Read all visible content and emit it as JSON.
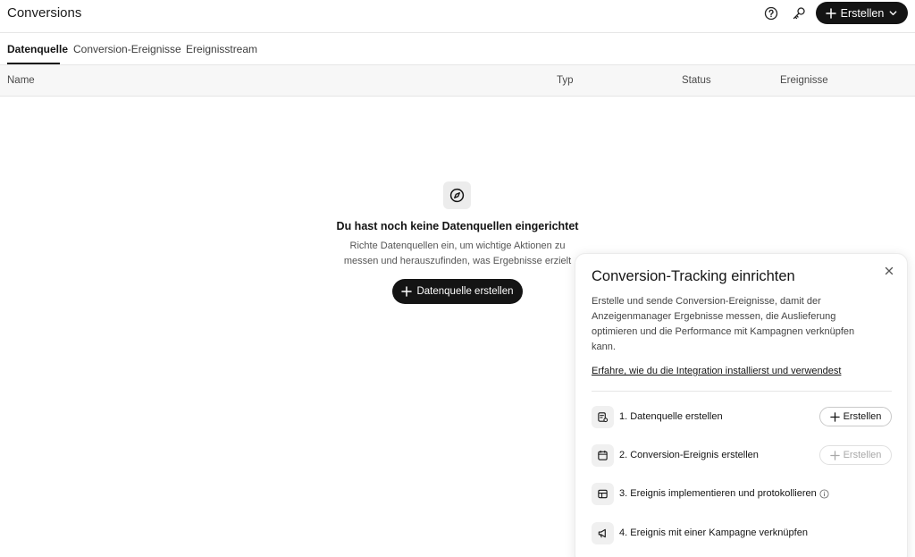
{
  "header": {
    "title": "Conversions",
    "create_label": "Erstellen",
    "icons": [
      "help-circle-icon",
      "key-icon",
      "plus-icon",
      "chevron-down-icon"
    ]
  },
  "tabs": [
    {
      "label": "Datenquelle",
      "active": true
    },
    {
      "label": "Conversion-Ereignisse",
      "active": false
    },
    {
      "label": "Ereignisstream",
      "active": false
    }
  ],
  "table": {
    "columns": [
      "Name",
      "Typ",
      "Status",
      "Ereignisse"
    ]
  },
  "empty_state": {
    "icon": "compass-icon",
    "title": "Du hast noch keine Datenquellen eingerichtet",
    "description_line1": "Richte Datenquellen ein, um wichtige Aktionen zu",
    "description_line2": "messen und herauszufinden, was Ergebnisse erzielt",
    "button_label": "Datenquelle erstellen"
  },
  "setup_panel": {
    "title": "Conversion-Tracking einrichten",
    "description": "Erstelle und sende Conversion-Ereignisse, damit der Anzeigenmanager Ergebnisse messen, die Auslieferung optimieren und die Performance mit Kampagnen verknüpfen kann.",
    "link": "Erfahre, wie du die Integration installierst und verwendest",
    "steps": [
      {
        "label": "1. Datenquelle erstellen",
        "icon": "data-source-icon",
        "button": "Erstellen",
        "button_enabled": true
      },
      {
        "label": "2. Conversion-Ereignis erstellen",
        "icon": "calendar-icon",
        "button": "Erstellen",
        "button_enabled": false
      },
      {
        "label": "3. Ereignis implementieren und protokollieren",
        "icon": "layout-icon",
        "has_info": true
      },
      {
        "label": "4. Ereignis mit einer Kampagne verknüpfen",
        "icon": "megaphone-icon"
      }
    ]
  },
  "colors": {
    "primary": "#141414",
    "border": "#e6e6e6",
    "header_bg": "#f7f7f7"
  }
}
